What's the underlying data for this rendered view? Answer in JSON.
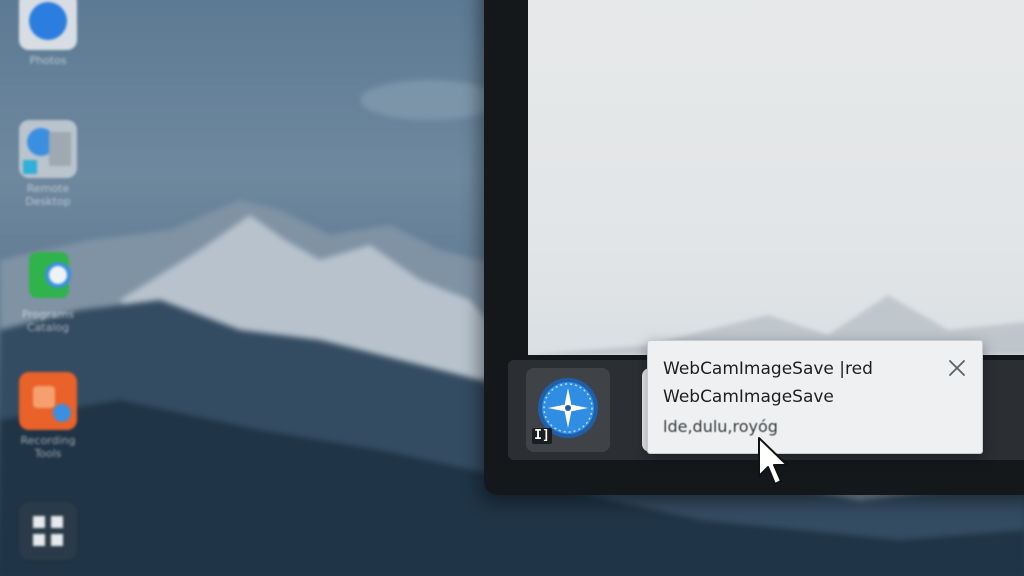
{
  "desktop": {
    "icons": [
      {
        "name": "Photos",
        "icon": "photos-icon",
        "color": "#2b7de0"
      },
      {
        "name": "Remote Desktop",
        "icon": "remote-desktop-icon",
        "color": "#3a8fe0"
      },
      {
        "name": "Programs Catalog",
        "icon": "programs-icon",
        "color": "#2fb34a"
      },
      {
        "name": "Recording Tools",
        "icon": "recording-icon",
        "color": "#e8622a"
      },
      {
        "name": "",
        "icon": "apps-grid-icon",
        "color": "#2a3a48"
      }
    ]
  },
  "taskbar": {
    "items": [
      {
        "icon": "compass-icon",
        "badge": "I]"
      },
      {
        "icon": "shield-icon"
      }
    ]
  },
  "notification": {
    "title": "WebCamImageSave |red",
    "app": "WebCamImageSave",
    "body": "lde,dulu,royóg",
    "close_icon": "close-icon"
  },
  "colors": {
    "accent": "#2f8de4",
    "toast_bg": "#eef0f1",
    "taskbar_bg": "#2b2f33",
    "monitor_bezel": "#15181b"
  }
}
